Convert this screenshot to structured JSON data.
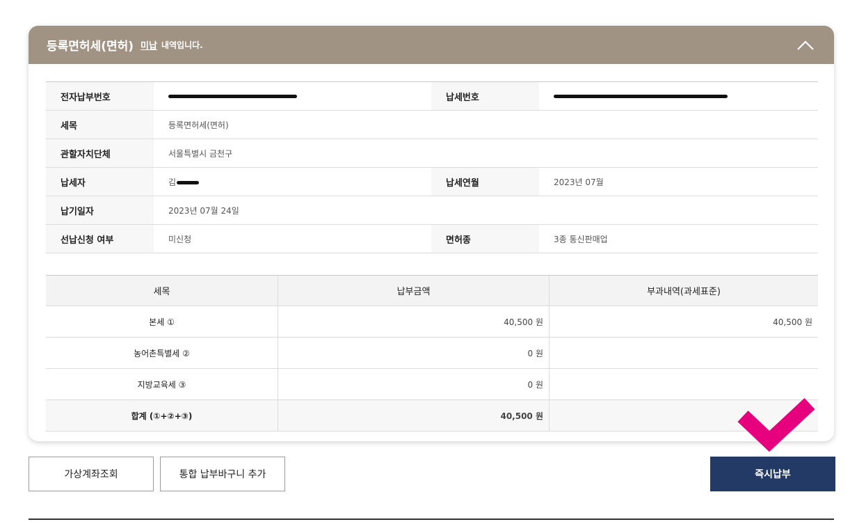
{
  "card": {
    "title": "등록면허세(면허)",
    "status": "미납",
    "suffix": "내역입니다."
  },
  "info": {
    "rows": [
      {
        "label": "전자납부번호",
        "value": "",
        "label2": "납세번호",
        "value2": ""
      },
      {
        "label": "세목",
        "value": "등록면허세(면허)"
      },
      {
        "label": "관할자치단체",
        "value": "서울특별시 금천구"
      },
      {
        "label": "납세자",
        "value": "김",
        "label2": "납세연월",
        "value2": "2023년 07월"
      },
      {
        "label": "납기일자",
        "value": "2023년 07월 24일"
      },
      {
        "label": "선납신청 여부",
        "value": "미신청",
        "label2": "면허종",
        "value2": "3종 통신판매업"
      }
    ]
  },
  "tax": {
    "headers": [
      "세목",
      "납부금액",
      "부과내역(과세표준)"
    ],
    "rows": [
      {
        "name": "본세 ①",
        "amount": "40,500 원",
        "std": "40,500 원"
      },
      {
        "name": "농어촌특별세 ②",
        "amount": "0 원",
        "std": ""
      },
      {
        "name": "지방교육세 ③",
        "amount": "0 원",
        "std": ""
      }
    ],
    "total": {
      "name": "합계 (①+②+③)",
      "amount": "40,500 원",
      "std": ""
    }
  },
  "buttons": {
    "virtual_account": "가상계좌조회",
    "add_cart": "통합 납부바구니 추가",
    "pay_now": "즉시납부"
  },
  "colors": {
    "header_bg": "#a09384",
    "primary": "#233a66",
    "annotation": "#e6007e"
  },
  "icons": {
    "collapse": "chevron-up-icon",
    "annotation": "checkmark-icon"
  }
}
